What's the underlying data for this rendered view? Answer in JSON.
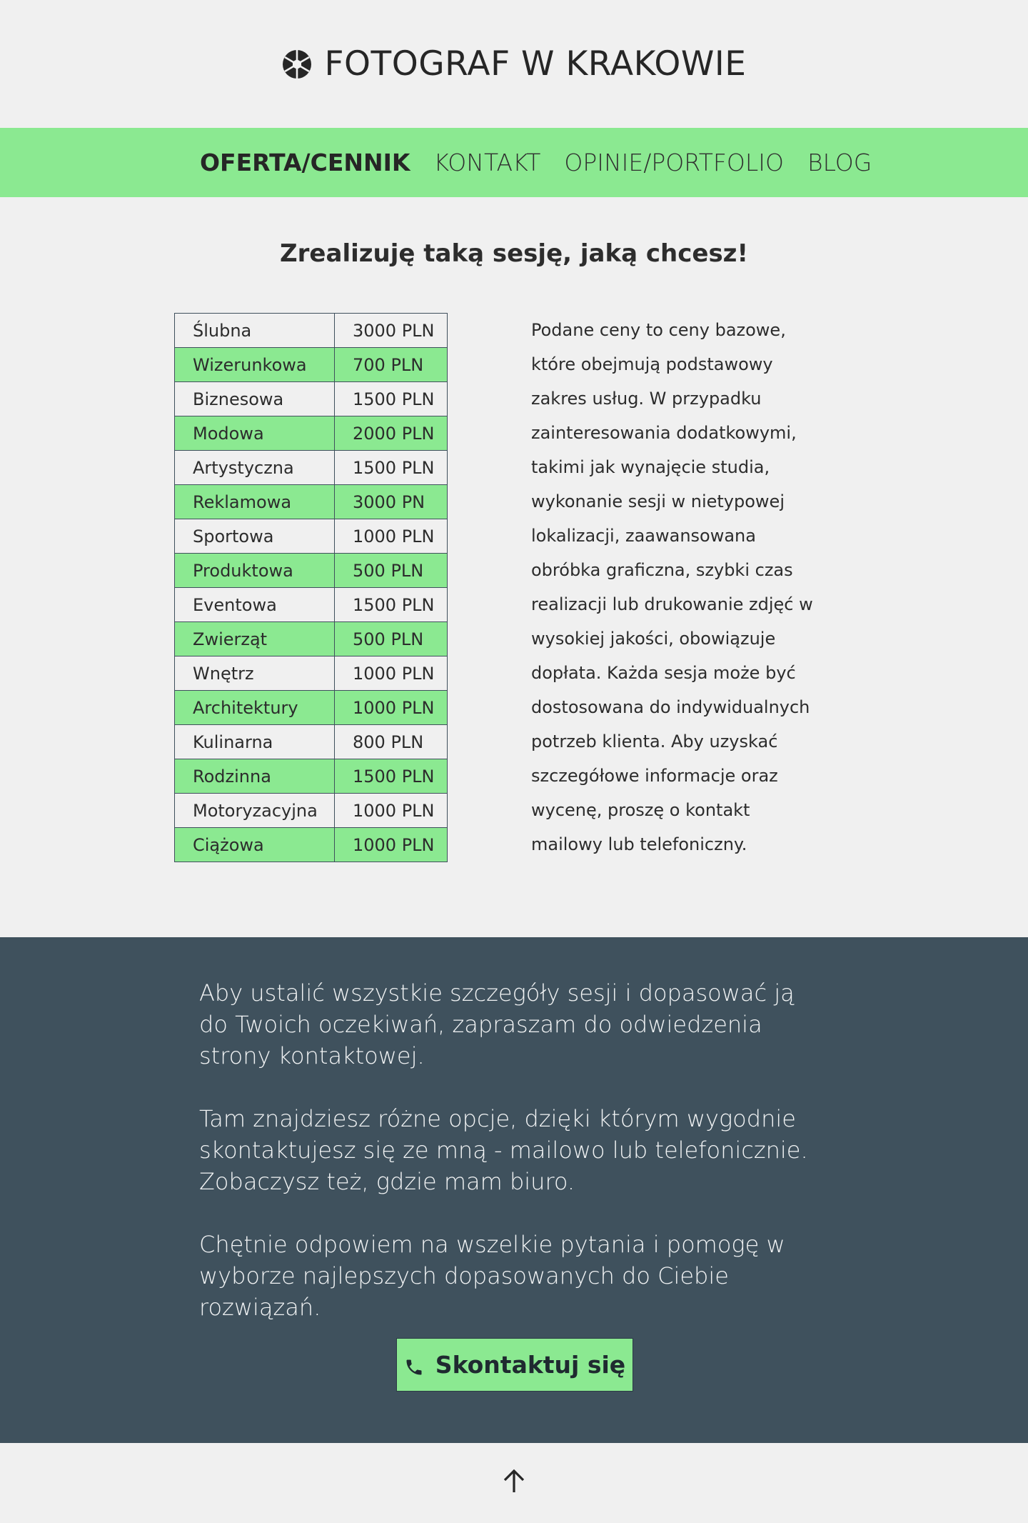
{
  "header": {
    "title": "FOTOGRAF W KRAKOWIE",
    "logo_icon": "camera-aperture-icon"
  },
  "nav": {
    "items": [
      {
        "label": "OFERTA/CENNIK",
        "active": true
      },
      {
        "label": "KONTAKT",
        "active": false
      },
      {
        "label": "OPINIE/PORTFOLIO",
        "active": false
      },
      {
        "label": "BLOG",
        "active": false
      }
    ]
  },
  "main": {
    "headline": "Zrealizuję taką sesję, jaką chcesz!",
    "prices": [
      {
        "name": "Ślubna",
        "price": "3000 PLN"
      },
      {
        "name": "Wizerunkowa",
        "price": "700 PLN"
      },
      {
        "name": "Biznesowa",
        "price": "1500 PLN"
      },
      {
        "name": "Modowa",
        "price": "2000 PLN"
      },
      {
        "name": "Artystyczna",
        "price": "1500 PLN"
      },
      {
        "name": "Reklamowa",
        "price": "3000 PN"
      },
      {
        "name": "Sportowa",
        "price": "1000 PLN"
      },
      {
        "name": "Produktowa",
        "price": "500 PLN"
      },
      {
        "name": "Eventowa",
        "price": "1500 PLN"
      },
      {
        "name": "Zwierząt",
        "price": "500 PLN"
      },
      {
        "name": "Wnętrz",
        "price": "1000 PLN"
      },
      {
        "name": "Architektury",
        "price": "1000 PLN"
      },
      {
        "name": "Kulinarna",
        "price": "800 PLN"
      },
      {
        "name": "Rodzinna",
        "price": "1500 PLN"
      },
      {
        "name": "Motoryzacyjna",
        "price": "1000 PLN"
      },
      {
        "name": "Ciążowa",
        "price": "1000 PLN"
      }
    ],
    "note_lines": [
      "Podane ceny to ceny bazowe,",
      "które obejmują podstawowy",
      "zakres usług. W przypadku",
      "zainteresowania dodatkowymi,",
      "takimi jak wynajęcie studia,",
      "wykonanie sesji w nietypowej",
      "lokalizacji, zaawansowana",
      "obróbka graficzna, szybki czas",
      "realizacji lub drukowanie zdjęć w",
      "wysokiej jakości, obowiązuje",
      "dopłata. Każda sesja może być",
      "dostosowana do indywidualnych",
      "potrzeb klienta. Aby uzyskać",
      "szczegółowe informacje oraz",
      "wycenę, proszę o kontakt",
      "mailowy lub telefoniczny."
    ]
  },
  "cta": {
    "paragraphs": [
      "Aby ustalić wszystkie szczegóły sesji i dopasować ją do Twoich oczekiwań, zapraszam do odwiedzenia strony kontaktowej.",
      "Tam znajdziesz różne opcje, dzięki którym wygodnie skontaktujesz się ze mną - mailowo lub telefonicznie. Zobaczysz też, gdzie mam biuro.",
      "Chętnie odpowiem na wszelkie pytania i pomogę w wyborze najlepszych dopasowanych do Ciebie rozwiązań."
    ],
    "button_label": "Skontaktuj się",
    "button_icon": "phone-icon"
  },
  "footer": {
    "back_to_top_icon": "arrow-up-icon"
  },
  "colors": {
    "background": "#f0f0f0",
    "accent_green": "#8be991",
    "cta_background": "#3f515d",
    "text_dark": "#2a2a2a"
  }
}
